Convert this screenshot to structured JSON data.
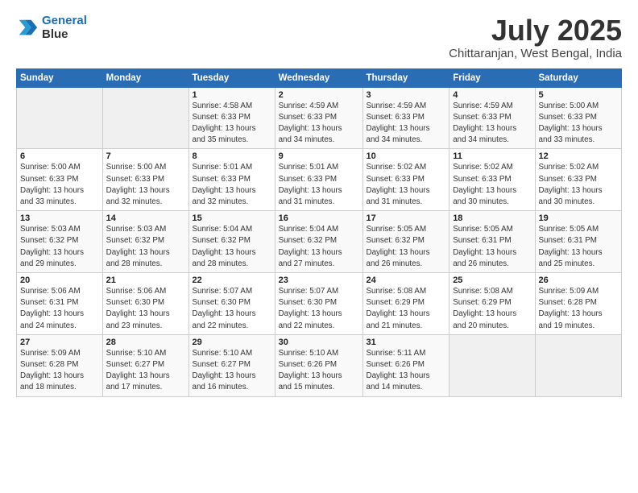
{
  "logo": {
    "line1": "General",
    "line2": "Blue"
  },
  "title": "July 2025",
  "subtitle": "Chittaranjan, West Bengal, India",
  "weekdays": [
    "Sunday",
    "Monday",
    "Tuesday",
    "Wednesday",
    "Thursday",
    "Friday",
    "Saturday"
  ],
  "weeks": [
    [
      {
        "day": "",
        "detail": ""
      },
      {
        "day": "",
        "detail": ""
      },
      {
        "day": "1",
        "detail": "Sunrise: 4:58 AM\nSunset: 6:33 PM\nDaylight: 13 hours\nand 35 minutes."
      },
      {
        "day": "2",
        "detail": "Sunrise: 4:59 AM\nSunset: 6:33 PM\nDaylight: 13 hours\nand 34 minutes."
      },
      {
        "day": "3",
        "detail": "Sunrise: 4:59 AM\nSunset: 6:33 PM\nDaylight: 13 hours\nand 34 minutes."
      },
      {
        "day": "4",
        "detail": "Sunrise: 4:59 AM\nSunset: 6:33 PM\nDaylight: 13 hours\nand 34 minutes."
      },
      {
        "day": "5",
        "detail": "Sunrise: 5:00 AM\nSunset: 6:33 PM\nDaylight: 13 hours\nand 33 minutes."
      }
    ],
    [
      {
        "day": "6",
        "detail": "Sunrise: 5:00 AM\nSunset: 6:33 PM\nDaylight: 13 hours\nand 33 minutes."
      },
      {
        "day": "7",
        "detail": "Sunrise: 5:00 AM\nSunset: 6:33 PM\nDaylight: 13 hours\nand 32 minutes."
      },
      {
        "day": "8",
        "detail": "Sunrise: 5:01 AM\nSunset: 6:33 PM\nDaylight: 13 hours\nand 32 minutes."
      },
      {
        "day": "9",
        "detail": "Sunrise: 5:01 AM\nSunset: 6:33 PM\nDaylight: 13 hours\nand 31 minutes."
      },
      {
        "day": "10",
        "detail": "Sunrise: 5:02 AM\nSunset: 6:33 PM\nDaylight: 13 hours\nand 31 minutes."
      },
      {
        "day": "11",
        "detail": "Sunrise: 5:02 AM\nSunset: 6:33 PM\nDaylight: 13 hours\nand 30 minutes."
      },
      {
        "day": "12",
        "detail": "Sunrise: 5:02 AM\nSunset: 6:33 PM\nDaylight: 13 hours\nand 30 minutes."
      }
    ],
    [
      {
        "day": "13",
        "detail": "Sunrise: 5:03 AM\nSunset: 6:32 PM\nDaylight: 13 hours\nand 29 minutes."
      },
      {
        "day": "14",
        "detail": "Sunrise: 5:03 AM\nSunset: 6:32 PM\nDaylight: 13 hours\nand 28 minutes."
      },
      {
        "day": "15",
        "detail": "Sunrise: 5:04 AM\nSunset: 6:32 PM\nDaylight: 13 hours\nand 28 minutes."
      },
      {
        "day": "16",
        "detail": "Sunrise: 5:04 AM\nSunset: 6:32 PM\nDaylight: 13 hours\nand 27 minutes."
      },
      {
        "day": "17",
        "detail": "Sunrise: 5:05 AM\nSunset: 6:32 PM\nDaylight: 13 hours\nand 26 minutes."
      },
      {
        "day": "18",
        "detail": "Sunrise: 5:05 AM\nSunset: 6:31 PM\nDaylight: 13 hours\nand 26 minutes."
      },
      {
        "day": "19",
        "detail": "Sunrise: 5:05 AM\nSunset: 6:31 PM\nDaylight: 13 hours\nand 25 minutes."
      }
    ],
    [
      {
        "day": "20",
        "detail": "Sunrise: 5:06 AM\nSunset: 6:31 PM\nDaylight: 13 hours\nand 24 minutes."
      },
      {
        "day": "21",
        "detail": "Sunrise: 5:06 AM\nSunset: 6:30 PM\nDaylight: 13 hours\nand 23 minutes."
      },
      {
        "day": "22",
        "detail": "Sunrise: 5:07 AM\nSunset: 6:30 PM\nDaylight: 13 hours\nand 22 minutes."
      },
      {
        "day": "23",
        "detail": "Sunrise: 5:07 AM\nSunset: 6:30 PM\nDaylight: 13 hours\nand 22 minutes."
      },
      {
        "day": "24",
        "detail": "Sunrise: 5:08 AM\nSunset: 6:29 PM\nDaylight: 13 hours\nand 21 minutes."
      },
      {
        "day": "25",
        "detail": "Sunrise: 5:08 AM\nSunset: 6:29 PM\nDaylight: 13 hours\nand 20 minutes."
      },
      {
        "day": "26",
        "detail": "Sunrise: 5:09 AM\nSunset: 6:28 PM\nDaylight: 13 hours\nand 19 minutes."
      }
    ],
    [
      {
        "day": "27",
        "detail": "Sunrise: 5:09 AM\nSunset: 6:28 PM\nDaylight: 13 hours\nand 18 minutes."
      },
      {
        "day": "28",
        "detail": "Sunrise: 5:10 AM\nSunset: 6:27 PM\nDaylight: 13 hours\nand 17 minutes."
      },
      {
        "day": "29",
        "detail": "Sunrise: 5:10 AM\nSunset: 6:27 PM\nDaylight: 13 hours\nand 16 minutes."
      },
      {
        "day": "30",
        "detail": "Sunrise: 5:10 AM\nSunset: 6:26 PM\nDaylight: 13 hours\nand 15 minutes."
      },
      {
        "day": "31",
        "detail": "Sunrise: 5:11 AM\nSunset: 6:26 PM\nDaylight: 13 hours\nand 14 minutes."
      },
      {
        "day": "",
        "detail": ""
      },
      {
        "day": "",
        "detail": ""
      }
    ]
  ]
}
